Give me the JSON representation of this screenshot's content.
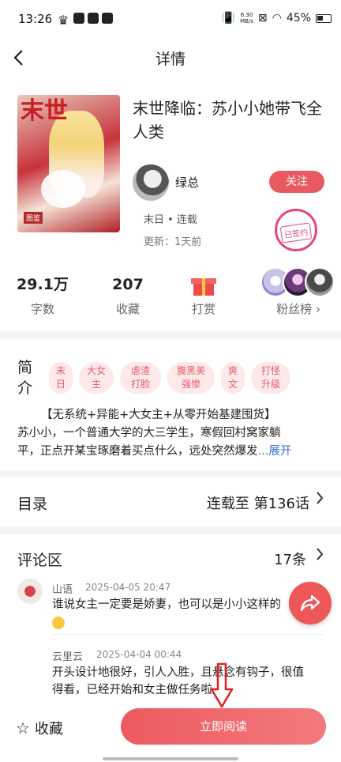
{
  "status": {
    "time": "13:26",
    "netspeed_value": "6.30",
    "netspeed_unit": "MB/s",
    "battery": "45%"
  },
  "nav": {
    "title": "详情"
  },
  "book": {
    "cover_text": "末世",
    "cover_tag": "图鉴",
    "title": "末世降临：苏小小她带飞全人类",
    "author": "绿总",
    "follow": "关注",
    "genre": "末日 • 连载",
    "updated": "更新：1天前",
    "stamp": "已签约"
  },
  "stats": {
    "words_value": "29.1万",
    "words_label": "字数",
    "favs_value": "207",
    "favs_label": "收藏",
    "reward_label": "打赏",
    "fans_label": "粉丝榜 ›"
  },
  "intro": {
    "heading": "简介",
    "tags": [
      {
        "l1": "末",
        "l2": "日"
      },
      {
        "l1": "大女",
        "l2": "主"
      },
      {
        "l1": "虐渣",
        "l2": "打脸"
      },
      {
        "l1": "腹黑美",
        "l2": "强惨"
      },
      {
        "l1": "爽",
        "l2": "文"
      },
      {
        "l1": "打怪",
        "l2": "升级"
      }
    ],
    "line1": "【无系统+异能+大女主+从零开始基建囤货】",
    "line2": "苏小小，一个普通大学的大三学生，寒假回村窝家躺",
    "line3": "平，正点开某宝琢磨着买点什么，远处突然爆发",
    "expand": "...展开"
  },
  "catalog": {
    "label": "目录",
    "value": "连载至 第136话"
  },
  "comments": {
    "label": "评论区",
    "count": "17条",
    "items": [
      {
        "user": "山语",
        "date": "2025-04-05 20:47",
        "text": "谁说女主一定要是娇妻，也可以是小小这样的"
      },
      {
        "user": "云里云",
        "date": "2025-04-04 00:44",
        "text1": "开头设计地很好，引人入胜，且悬念有钩子，很值",
        "text2": "得看，已经开始和女主做任务啦"
      }
    ]
  },
  "bottom": {
    "fav_label": "收藏",
    "read_label": "立即阅读"
  },
  "colors": {
    "accent": "#e85a5f",
    "tag_bg": "#fde8ea",
    "link": "#3a6fd8"
  }
}
